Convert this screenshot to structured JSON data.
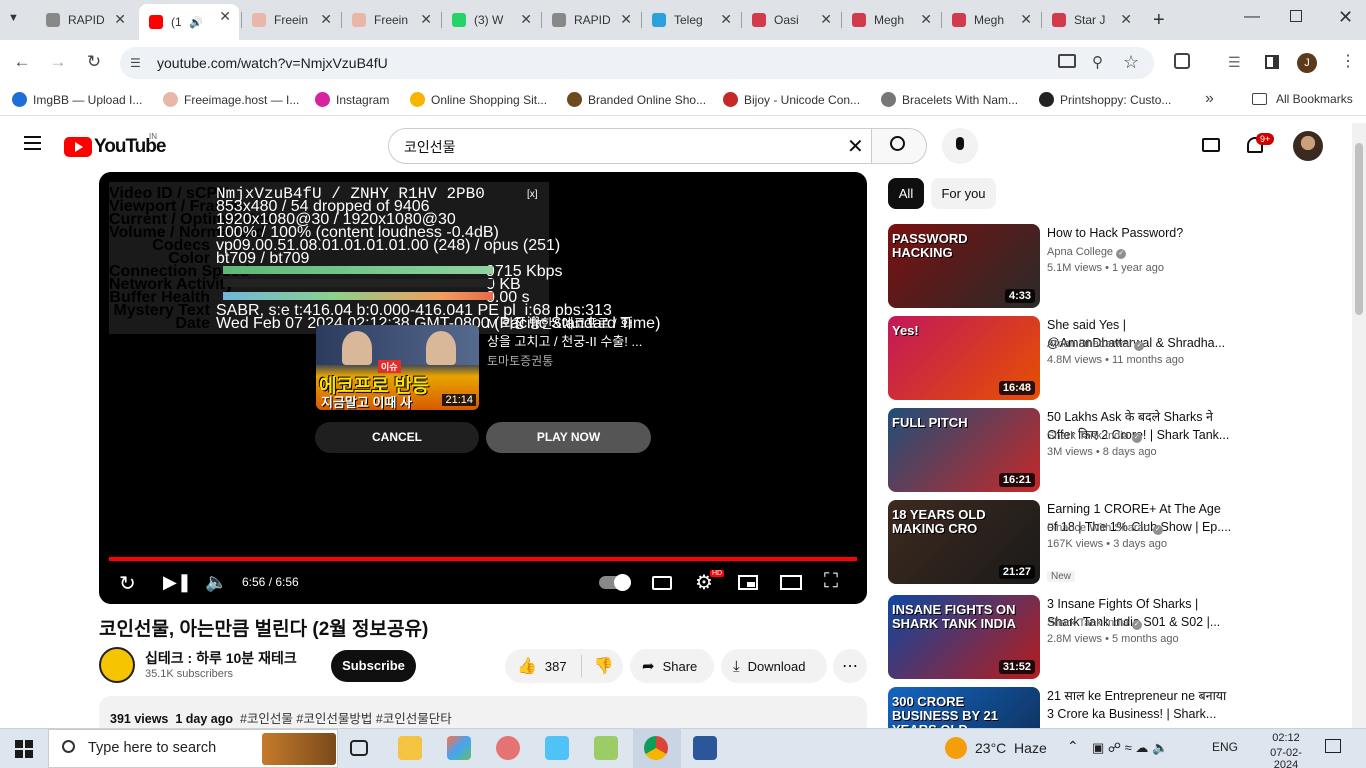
{
  "tabs": [
    {
      "title": "RAPID",
      "icon_color": "#888888",
      "icon": "rapid-icon"
    },
    {
      "title": "(1",
      "icon_color": "#ff0000",
      "icon": "youtube-icon"
    },
    {
      "title": "Freein",
      "icon_color": "#e9b7a8",
      "icon": "freeimage-icon"
    },
    {
      "title": "Freein",
      "icon_color": "#e9b7a8",
      "icon": "freeimage-icon"
    },
    {
      "title": "(3) W",
      "icon_color": "#25d366",
      "icon": "whatsapp-icon"
    },
    {
      "title": "RAPID",
      "icon_color": "#888888",
      "icon": "rapid-icon"
    },
    {
      "title": "Teleg",
      "icon_color": "#2aa1da",
      "icon": "telegram-icon"
    },
    {
      "title": "Oasi",
      "icon_color": "#d13b4b",
      "icon": "heart-chat-icon"
    },
    {
      "title": "Megh",
      "icon_color": "#d13b4b",
      "icon": "heart-chat-icon"
    },
    {
      "title": "Megh",
      "icon_color": "#d13b4b",
      "icon": "heart-chat-icon"
    },
    {
      "title": "Star J",
      "icon_color": "#d13b4b",
      "icon": "heart-chat-icon"
    }
  ],
  "address": {
    "url": "youtube.com/watch?v=NmjxVzuB4fU"
  },
  "profile_initial": "J",
  "bookmarks": [
    {
      "label": "ImgBB — Upload I...",
      "color": "#1d6fd6"
    },
    {
      "label": "Freeimage.host — I...",
      "color": "#e9b7a8"
    },
    {
      "label": "Instagram",
      "color": "#d6249f"
    },
    {
      "label": "Online Shopping Sit...",
      "color": "#f7b500"
    },
    {
      "label": "Branded Online Sho...",
      "color": "#6b4a1e"
    },
    {
      "label": "Bijoy - Unicode Con...",
      "color": "#c62828"
    },
    {
      "label": "Bracelets With Nam...",
      "color": "#777777"
    },
    {
      "label": "Printshoppy: Custo...",
      "color": "#222222"
    }
  ],
  "all_bookmarks": "All Bookmarks",
  "yt": {
    "logo_text": "YouTube",
    "country": "IN",
    "search_query": "코인선물",
    "notif_count": "9+"
  },
  "stats": [
    {
      "label": "Video ID / sCPN",
      "value": "NmjxVzuB4fU / ZNHY R1HV 2PB0"
    },
    {
      "label": "Viewport / Frames",
      "value": "853x480 / 54 dropped of 9406"
    },
    {
      "label": "Current / Optimal Res",
      "value": "1920x1080@30 / 1920x1080@30"
    },
    {
      "label": "Volume / Normalized",
      "value": "100% / 100% (content loudness -0.4dB)"
    },
    {
      "label": "Codecs",
      "value": "vp09.00.51.08.01.01.01.01.00 (248) / opus (251)"
    },
    {
      "label": "Color",
      "value": "bt709 / bt709"
    },
    {
      "label": "Connection Speed",
      "value": "9715 Kbps"
    },
    {
      "label": "Network Activity",
      "value": "0 KB"
    },
    {
      "label": "Buffer Health",
      "value": "0.00 s"
    },
    {
      "label": "Mystery Text",
      "value": "SABR, s:e t:416.04 b:0.000-416.041 PE pl_i:68 pbs:313"
    },
    {
      "label": "Date",
      "value": "Wed Feb 07 2024 02:12:38 GMT-0800 (Pacific Standard Time)"
    }
  ],
  "stats_close": "[x]",
  "endscreen": {
    "title_line1": "M 회장 방한&에코프로 / 화",
    "title_line2": "상을 고치고 / 천궁-II 수출! ...",
    "channel": "토마토증권통",
    "thumb_big": "에코프로 반등",
    "thumb_sub": "지금말고 이때 사",
    "thumb_badge": "이슈",
    "duration": "21:14",
    "cancel": "CANCEL",
    "play_now": "PLAY NOW"
  },
  "player": {
    "time": "6:56 / 6:56",
    "progress": 1.0,
    "hd_badge": "HD"
  },
  "video": {
    "title": "코인선물, 아는만큼 벌린다 (2월 정보공유)",
    "channel": "십테크 : 하루 10분 재테크",
    "subscribers": "35.1K subscribers",
    "subscribe": "Subscribe",
    "likes": "387",
    "share": "Share",
    "download": "Download",
    "views": "391 views",
    "age": "1 day ago",
    "hashtags": "#코인선물 #코인선물방법 #코인선물단타"
  },
  "chips": {
    "all": "All",
    "for_you": "For you"
  },
  "recommendations": [
    {
      "title": "How to Hack Password?",
      "channel": "Apna College",
      "meta": "5.1M views • 1 year ago",
      "duration": "4:33",
      "thumb_text": "PASSWORD HACKING",
      "c1": "#7a1010",
      "c2": "#2a2a2a"
    },
    {
      "title": "She said Yes | @AmanDhattarwal & Shradha...",
      "channel": "Aman Dhattarwal",
      "meta": "4.8M views • 11 months ago",
      "duration": "16:48",
      "thumb_text": "Yes!",
      "c1": "#c2185b",
      "c2": "#e65100"
    },
    {
      "title": "50 Lakhs Ask के बदले Sharks ने Offer किए 2 Crore! | Shark Tank...",
      "channel": "Shark Tank India",
      "meta": "3M views • 8 days ago",
      "duration": "16:21",
      "thumb_text": "FULL PITCH",
      "c1": "#1f4e79",
      "c2": "#c62828"
    },
    {
      "title": "Earning 1 CRORE+ At The Age of 18 | The 1% Club Show | Ep....",
      "channel": "Finance With Sharan",
      "meta": "167K views • 3 days ago",
      "duration": "21:27",
      "thumb_text": "18 YEARS OLD MAKING CRO",
      "badge": "New",
      "c1": "#3e2a1e",
      "c2": "#1a1a1a"
    },
    {
      "title": "3 Insane Fights Of Sharks | Shark Tank India S01 & S02 |...",
      "channel": "Shark Tank India",
      "meta": "2.8M views • 5 months ago",
      "duration": "31:52",
      "thumb_text": "INSANE FIGHTS ON SHARK TANK INDIA",
      "c1": "#0d47a1",
      "c2": "#b71c1c"
    },
    {
      "title": "21 साल ke Entrepreneur ne बनाया 3 Crore ka Business! | Shark...",
      "channel": "",
      "meta": "",
      "duration": "",
      "thumb_text": "300 CRORE BUSINESS BY 21 YEARS OLD",
      "c1": "#1565c0",
      "c2": "#0d2b52"
    }
  ],
  "taskbar": {
    "search_placeholder": "Type here to search",
    "weather": "23°C  Haze",
    "lang": "ENG",
    "time": "02:12",
    "date": "07-02-2024"
  }
}
